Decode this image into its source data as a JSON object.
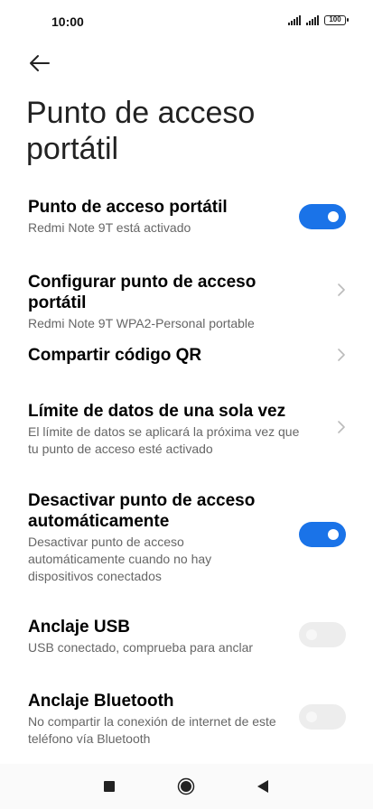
{
  "status": {
    "time": "10:00",
    "battery": "100"
  },
  "page": {
    "title": "Punto de acceso portátil"
  },
  "settings": [
    {
      "title": "Punto de acceso portátil",
      "subtitle": "Redmi Note 9T está activado"
    },
    {
      "title": "Configurar punto de acceso portátil",
      "subtitle": "Redmi Note 9T WPA2-Personal portable"
    },
    {
      "title": "Compartir código QR",
      "subtitle": ""
    },
    {
      "title": "Límite de datos de una sola vez",
      "subtitle": "El límite de datos se aplicará la próxima vez que tu punto de acceso esté activado"
    },
    {
      "title": "Desactivar punto de acceso automáticamente",
      "subtitle": "Desactivar punto de acceso automáticamente cuando no hay dispositivos conectados"
    },
    {
      "title": "Anclaje USB",
      "subtitle": "USB conectado, comprueba para anclar"
    },
    {
      "title": "Anclaje Bluetooth",
      "subtitle": "No compartir la conexión de internet de este teléfono vía Bluetooth"
    }
  ],
  "toggles": {
    "hotspot": true,
    "auto_off": true,
    "usb": false,
    "bluetooth": false
  },
  "colors": {
    "accent": "#1a73e8",
    "toggle_off": "#ededed",
    "subtitle": "#666666"
  },
  "icons": [
    "signal-icon",
    "battery-icon",
    "back-arrow-icon",
    "chevron-right-icon",
    "stop-icon",
    "home-icon",
    "back-icon"
  ]
}
